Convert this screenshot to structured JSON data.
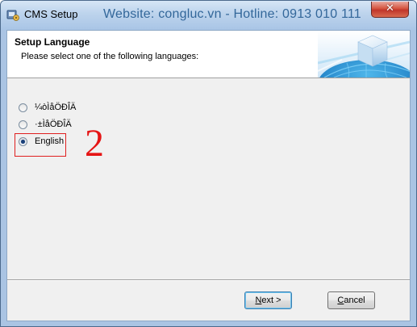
{
  "window": {
    "title": "CMS Setup",
    "watermark": "Website: congluc.vn - Hotline: 0913 010 111",
    "close_glyph": "✕"
  },
  "header": {
    "title": "Setup Language",
    "subtitle": "Please select one of the following languages:"
  },
  "languages": [
    {
      "label": "¼òÌåÖÐÎÄ",
      "selected": false
    },
    {
      "label": "·±ÌåÖÐÎÄ",
      "selected": false
    },
    {
      "label": "English",
      "selected": true
    }
  ],
  "annotation": {
    "number": "2",
    "color": "#e51414"
  },
  "buttons": {
    "next_mnemonic": "N",
    "next_rest": "ext >",
    "cancel_mnemonic": "C",
    "cancel_rest": "ancel"
  },
  "icons": {
    "app": "setup-app-icon",
    "close": "close-icon",
    "header": "globe-cube-icon"
  }
}
